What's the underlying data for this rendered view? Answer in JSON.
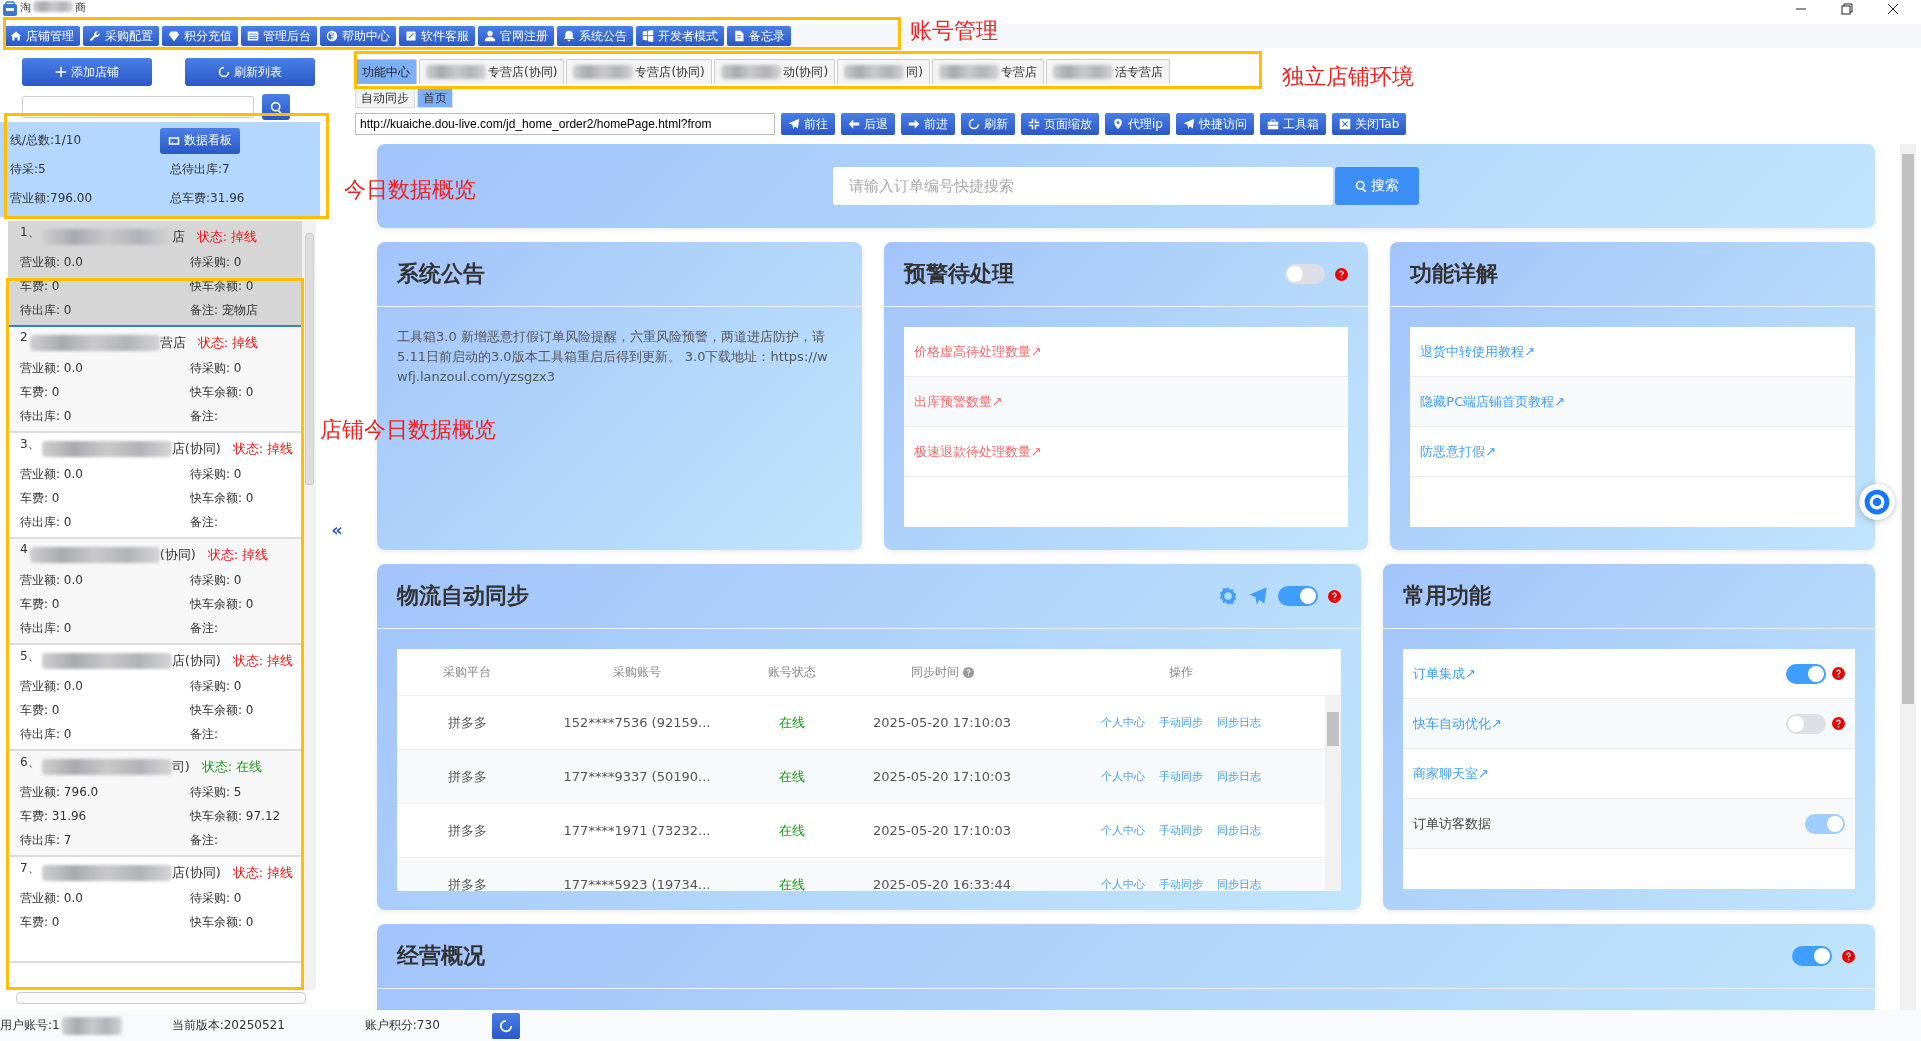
{
  "window": {
    "title_start": "淘",
    "title_end": "商"
  },
  "toolbar": [
    {
      "label": "店铺管理"
    },
    {
      "label": "采购配置"
    },
    {
      "label": "积分充值"
    },
    {
      "label": "管理后台"
    },
    {
      "label": "帮助中心"
    },
    {
      "label": "软件客服"
    },
    {
      "label": "官网注册"
    },
    {
      "label": "系统公告"
    },
    {
      "label": "开发者模式"
    },
    {
      "label": "备忘录"
    }
  ],
  "left": {
    "add_button": "添加店铺",
    "refresh_button": "刷新列表",
    "summary": {
      "online": "线/总数:1/10",
      "board_button": "数据看板",
      "pending_purchase": "待采:5",
      "pending_out": "总待出库:7",
      "revenue": "营业额:796.00",
      "fare": "总车费:31.96"
    },
    "shops": [
      {
        "index": "1、",
        "name": "店",
        "status": "状态: 掉线",
        "online": false,
        "selected": true,
        "fields": [
          "营业额: 0.0",
          "待采购: 0",
          "车费: 0",
          "快车余额: 0",
          "待出库: 0",
          "备注: 宠物店"
        ]
      },
      {
        "index": "2",
        "name": "营店",
        "status": "状态: 掉线",
        "online": false,
        "selected": false,
        "fields": [
          "营业额: 0.0",
          "待采购: 0",
          "车费: 0",
          "快车余额: 0",
          "待出库: 0",
          "备注:"
        ]
      },
      {
        "index": "3、",
        "name": "店(协同)",
        "status": "状态: 掉线",
        "online": false,
        "selected": false,
        "fields": [
          "营业额: 0.0",
          "待采购: 0",
          "车费: 0",
          "快车余额: 0",
          "待出库: 0",
          "备注:"
        ]
      },
      {
        "index": "4",
        "name": "(协同)",
        "status": "状态: 掉线",
        "online": false,
        "selected": false,
        "fields": [
          "营业额: 0.0",
          "待采购: 0",
          "车费: 0",
          "快车余额: 0",
          "待出库: 0",
          "备注:"
        ]
      },
      {
        "index": "5、",
        "name": "店(协同)",
        "status": "状态: 掉线",
        "online": false,
        "selected": false,
        "fields": [
          "营业额: 0.0",
          "待采购: 0",
          "车费: 0",
          "快车余额: 0",
          "待出库: 0",
          "备注:"
        ]
      },
      {
        "index": "6、",
        "name": "司)",
        "status": "状态: 在线",
        "online": true,
        "selected": false,
        "fields": [
          "营业额: 796.0",
          "待采购: 5",
          "车费: 31.96",
          "快车余额: 97.12",
          "待出库: 7",
          "备注:"
        ]
      },
      {
        "index": "7、",
        "name": "店(协同)",
        "status": "状态: 掉线",
        "online": false,
        "selected": false,
        "fields": [
          "营业额: 0.0",
          "待采购: 0",
          "车费: 0",
          "快车余额: 0"
        ]
      }
    ]
  },
  "collapse": "«",
  "tabs": [
    {
      "label": "功能中心",
      "selected": true
    },
    {
      "label": "专营店(协同)",
      "selected": false
    },
    {
      "label": "专营店(协同)",
      "selected": false
    },
    {
      "label": "动(协同)",
      "selected": false
    },
    {
      "label": "同)",
      "selected": false
    },
    {
      "label": "专营店",
      "selected": false
    },
    {
      "label": "活专营店",
      "selected": false
    }
  ],
  "subtabs": [
    {
      "label": "自动同步",
      "selected": false
    },
    {
      "label": "首页",
      "selected": true
    }
  ],
  "address": "http://kuaiche.dou-live.com/jd_home_order2/homePage.html?from",
  "nav_buttons": [
    {
      "label": "前往"
    },
    {
      "label": "后退"
    },
    {
      "label": "前进"
    },
    {
      "label": "刷新"
    },
    {
      "label": "页面缩放"
    },
    {
      "label": "代理ip"
    },
    {
      "label": "快捷访问"
    },
    {
      "label": "工具箱"
    },
    {
      "label": "关闭Tab"
    }
  ],
  "search": {
    "placeholder": "请输入订单编号快捷搜索",
    "button": "搜索"
  },
  "notice": {
    "title": "系统公告",
    "text": "工具箱3.0 新增恶意打假订单风险提醒，六重风险预警，两道进店防护，请5.11日前启动的3.0版本工具箱重启后得到更新。 3.0下载地址：https://wwfj.lanzoul.com/yzsgzx3"
  },
  "alerts": {
    "title": "预警待处理",
    "on": false,
    "links": [
      "价格虚高待处理数量↗",
      "出库预警数量↗",
      "极速退款待处理数量↗"
    ]
  },
  "features": {
    "title": "功能详解",
    "links": [
      "退货中转使用教程↗",
      "隐藏PC端店铺首页教程↗",
      "防恶意打假↗"
    ]
  },
  "logistics": {
    "title": "物流自动同步",
    "on": true,
    "columns": [
      "采购平台",
      "采购账号",
      "账号状态",
      "同步时间",
      "操作"
    ],
    "rows": [
      {
        "platform": "拼多多",
        "account": "152****7536 (92159...",
        "status": "在线",
        "time": "2025-05-20 17:10:03",
        "actions": [
          "个人中心",
          "手动同步",
          "同步日志"
        ]
      },
      {
        "platform": "拼多多",
        "account": "177****9337 (50190...",
        "status": "在线",
        "time": "2025-05-20 17:10:03",
        "actions": [
          "个人中心",
          "手动同步",
          "同步日志"
        ]
      },
      {
        "platform": "拼多多",
        "account": "177****1971 (73232...",
        "status": "在线",
        "time": "2025-05-20 17:10:03",
        "actions": [
          "个人中心",
          "手动同步",
          "同步日志"
        ]
      },
      {
        "platform": "拼多多",
        "account": "177****5923 (19734...",
        "status": "在线",
        "time": "2025-05-20 16:33:44",
        "actions": [
          "个人中心",
          "手动同步",
          "同步日志"
        ]
      }
    ]
  },
  "common": {
    "title": "常用功能",
    "items": [
      {
        "label": "订单集成↗",
        "kind": "link",
        "on": true,
        "disabled": false,
        "help": true
      },
      {
        "label": "快车自动优化↗",
        "kind": "link",
        "on": false,
        "disabled": false,
        "help": true
      },
      {
        "label": "商家聊天室↗",
        "kind": "link"
      },
      {
        "label": "订单访客数据",
        "kind": "plain",
        "on": true,
        "disabled": true,
        "help": false
      }
    ]
  },
  "business": {
    "title": "经营概况",
    "on": true
  },
  "status_bar": {
    "account": "用户账号:1",
    "version": "当前版本:20250521",
    "points": "账户积分:730"
  },
  "annotations": [
    "账号管理",
    "独立店铺环境",
    "今日数据概览",
    "店铺今日数据概览"
  ]
}
